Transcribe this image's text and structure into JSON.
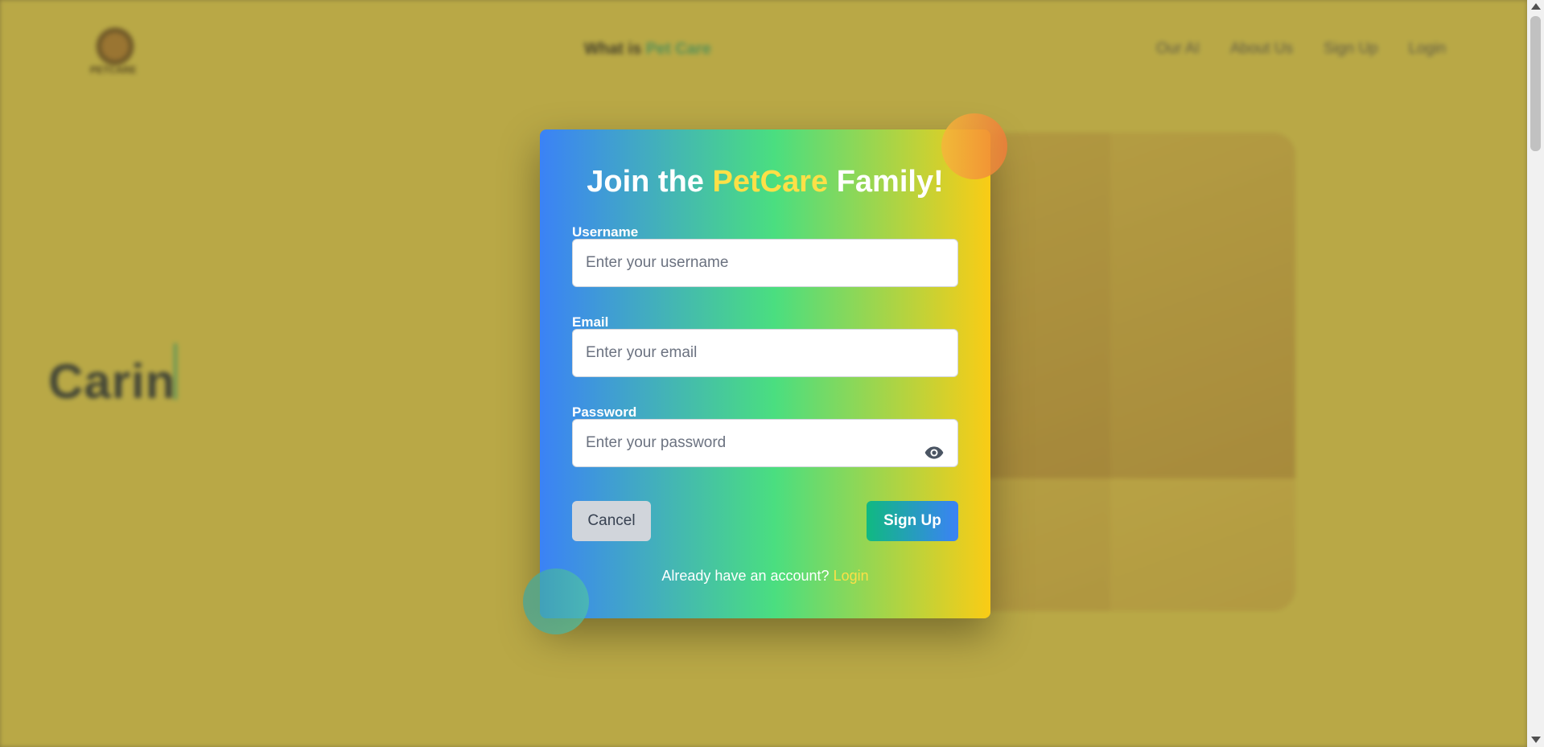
{
  "background": {
    "logo_text": "PETCARE",
    "nav_center": {
      "prefix": "What is",
      "accent": "Pet Care"
    },
    "nav_links": [
      "Our AI",
      "About Us",
      "Sign Up",
      "Login"
    ],
    "headline": "Carin"
  },
  "modal": {
    "title_prefix": "Join the",
    "title_brand": "PetCare",
    "title_suffix": "Family!",
    "fields": {
      "username": {
        "label": "Username",
        "placeholder": "Enter your username",
        "value": ""
      },
      "email": {
        "label": "Email",
        "placeholder": "Enter your email",
        "value": ""
      },
      "password": {
        "label": "Password",
        "placeholder": "Enter your password",
        "value": ""
      }
    },
    "cancel_label": "Cancel",
    "signup_label": "Sign Up",
    "footer_prompt": "Already have an account?",
    "footer_link": "Login"
  },
  "colors": {
    "gradient_start": "#3b82f6",
    "gradient_mid": "#4ade80",
    "gradient_end": "#facc15",
    "brand_yellow": "#fde047"
  }
}
